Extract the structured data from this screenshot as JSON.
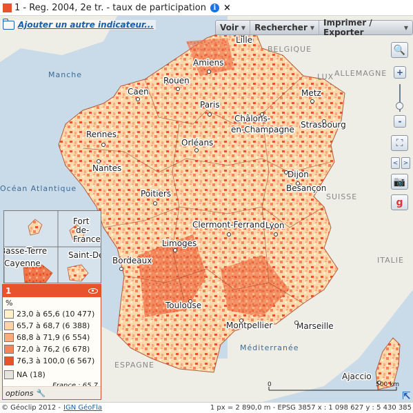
{
  "title": {
    "text": "1 - Reg. 2004, 2e tr. - taux de participation",
    "swatch_color": "#e8532c",
    "info_icon": "info-icon",
    "info_glyph": "i",
    "close_glyph": "×"
  },
  "toolbar": {
    "add_indicator": "Ajouter un autre indicateur...",
    "menus": [
      "Voir",
      "Rechercher",
      "Imprimer / Exporter"
    ]
  },
  "map_tools": {
    "zoom_in": "+",
    "zoom_out": "-",
    "pan_left": "<",
    "pan_right": ">"
  },
  "map_labels": {
    "cities": [
      "Lille",
      "Amiens",
      "Rouen",
      "Caen",
      "Paris",
      "Metz",
      "Châlons-",
      "en-Champagne",
      "Strasbourg",
      "Rennes",
      "Orléans",
      "Nantes",
      "Dijon",
      "Besançon",
      "Poitiers",
      "Clermont-Ferrand",
      "Lyon",
      "Limoges",
      "Bordeaux",
      "Toulouse",
      "Montpellier",
      "Marseille",
      "Ajaccio"
    ],
    "seas": [
      "Manche",
      "Océan Atlantique",
      "Méditerranée"
    ],
    "countries": [
      "BELGIQUE",
      "LUX",
      "ALLEMAGNE",
      "SUISSE",
      "ITALIE",
      "ESPAGNE"
    ],
    "overseas": [
      "Fort",
      "de-",
      "France",
      "Basse-Terre",
      "Saint-Denis",
      "Cayenne"
    ]
  },
  "legend": {
    "number": "1",
    "unit": "%",
    "classes": [
      {
        "label": "23,0 à 65,6 (10 477)",
        "color": "#fff1c9"
      },
      {
        "label": "65,7 à 68,7 (6 388)",
        "color": "#fdd3a3"
      },
      {
        "label": "68,8 à 71,9 (6 554)",
        "color": "#fbab7b"
      },
      {
        "label": "72,0 à 76,2 (6 678)",
        "color": "#f48459"
      },
      {
        "label": "76,3 à 100,0 (6 567)",
        "color": "#e8532c"
      }
    ],
    "na": {
      "label": "NA (18)",
      "color": "#e6e2dc"
    },
    "total": "France : 65,7",
    "options": "options"
  },
  "scale": {
    "start": "0",
    "end": "500 km"
  },
  "status": {
    "copyright": "© Géoclip 2012 -",
    "link": "IGN GéoFla",
    "info": "1 px = 2 890,0 m - EPSG 3857   x : 1 098 627   y : 5 430 385"
  }
}
